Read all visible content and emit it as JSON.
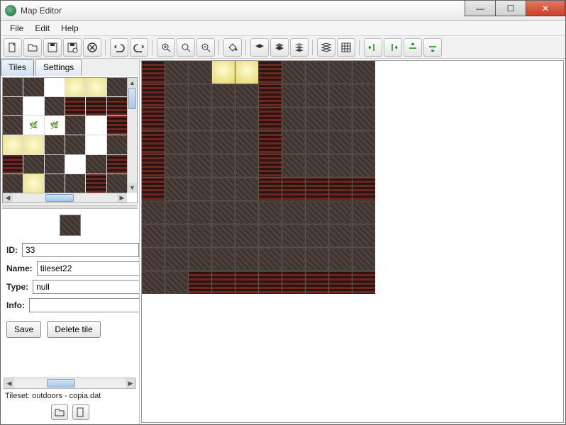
{
  "window": {
    "title": "Map Editor"
  },
  "menu": {
    "file": "File",
    "edit": "Edit",
    "help": "Help"
  },
  "toolbar": {
    "new": "new",
    "open": "open",
    "save": "save",
    "saveas": "saveas",
    "close": "close",
    "undo": "undo",
    "redo": "redo",
    "zoomin": "zoomin",
    "zoomfit": "zoomfit",
    "zoomout": "zoomout",
    "fill": "fill",
    "layer1": "layer1",
    "layer2": "layer2",
    "layer3": "layer3",
    "layerall": "layerall",
    "grid": "grid",
    "eraser1": "eraser1",
    "eraser2": "eraser2",
    "eraser3": "eraser3",
    "eraser4": "eraser4"
  },
  "tabs": {
    "tiles": "Tiles",
    "settings": "Settings"
  },
  "props": {
    "id_label": "ID:",
    "id_value": "33",
    "name_label": "Name:",
    "name_value": "tileset22",
    "type_label": "Type:",
    "type_value": "null",
    "info_label": "Info:",
    "info_value": ""
  },
  "buttons": {
    "save": "Save",
    "delete": "Delete tile"
  },
  "tileset": {
    "label": "Tileset: outdoors - copia.dat"
  }
}
